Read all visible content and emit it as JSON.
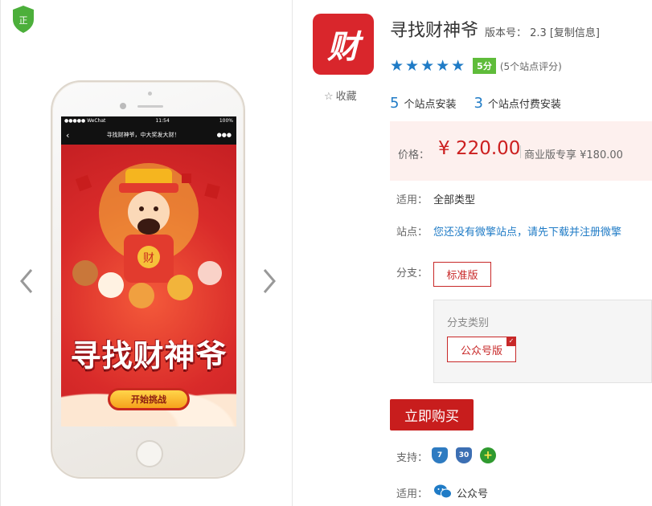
{
  "badge": {
    "label": "正",
    "icon": "verified-shield-icon"
  },
  "carousel": {
    "prev_icon": "chevron-left-icon",
    "next_icon": "chevron-right-icon"
  },
  "phone_screen": {
    "status_left": "●●●●● WeChat",
    "status_time": "11:54",
    "status_right": "100%",
    "nav_back": "‹",
    "nav_title": "寻找财神爷，中大奖发大财！",
    "nav_more": "●●●",
    "game_title": "寻找财神爷",
    "start_button": "开始挑战"
  },
  "app": {
    "icon_text": "财",
    "favorite_label": "收藏",
    "title": "寻找财神爷",
    "version_label": "版本号： 2.3",
    "copy_info": "[复制信息]",
    "stars": "★★★★★",
    "score": "5分",
    "score_note": "(5个站点评分)",
    "install_count": "5",
    "install_label": "个站点安装",
    "paid_count": "3",
    "paid_label": "个站点付费安装"
  },
  "price": {
    "label": "价格：",
    "value": "¥ 220.00",
    "business": "商业版专享 ¥180.00"
  },
  "details": {
    "apply_label": "适用：",
    "apply_value": "全部类型",
    "site_label": "站点：",
    "site_value": "您还没有微擎站点，请先下载并注册微擎",
    "branch_label": "分支：",
    "branch_option": "标准版",
    "branch_type_title": "分支类别",
    "branch_type_option": "公众号版",
    "buy_button": "立即购买",
    "support_label": "支持：",
    "support_icons": [
      "7",
      "30",
      "+"
    ],
    "platform_label": "适用：",
    "platform_value": "公众号"
  },
  "colors": {
    "accent_red": "#c81d1d",
    "link_blue": "#1f7bc6",
    "score_green": "#5fbc3a",
    "price_bg": "#fdf0ee"
  }
}
